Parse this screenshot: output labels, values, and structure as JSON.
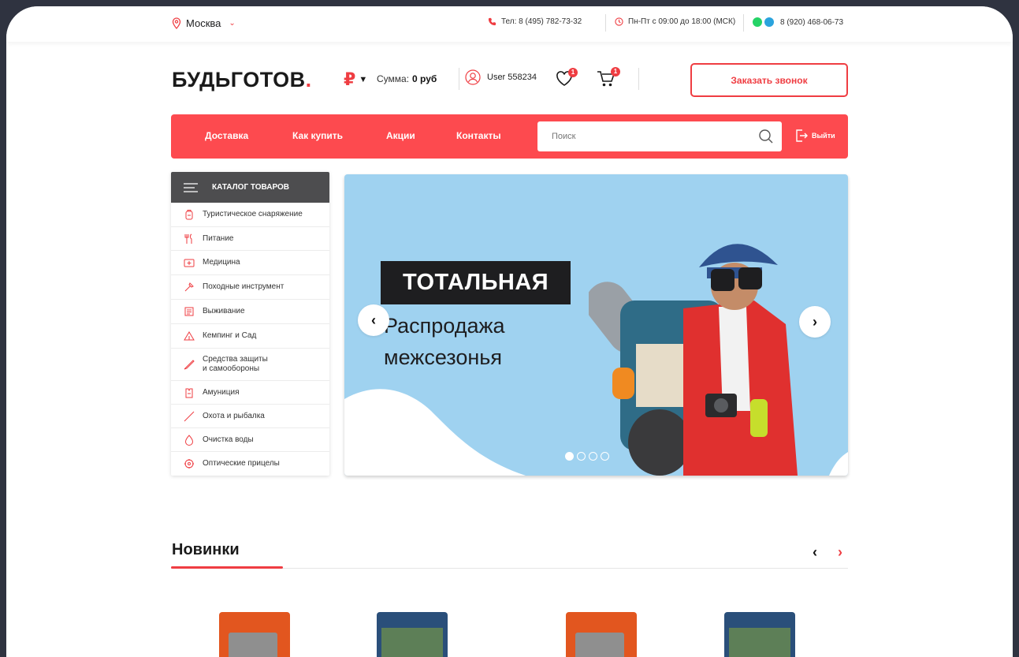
{
  "topbar": {
    "city": "Москва",
    "phone": "Тел: 8 (495) 782-73-32",
    "hours": "Пн-Пт с 09:00 до 18:00 (МСК)",
    "messenger_phone": "8 (920) 468-06-73"
  },
  "header": {
    "logo": "БУДЬГОТОВ",
    "logo_dot": ".",
    "currency_symbol": "₽",
    "sum_label": "Сумма:",
    "sum_value": "0 руб",
    "user": "User 558234",
    "favorites_count": "1",
    "cart_count": "1",
    "callback_button": "Заказать звонок"
  },
  "nav": {
    "items": [
      "Доставка",
      "Как купить",
      "Акции",
      "Контакты"
    ],
    "search_placeholder": "Поиск",
    "logout": "Выйти"
  },
  "catalog": {
    "title": "КАТАЛОГ ТОВАРОВ",
    "items": [
      {
        "label": "Туристическое снаряжение",
        "icon": "backpack-icon"
      },
      {
        "label": "Питание",
        "icon": "cutlery-icon"
      },
      {
        "label": "Медицина",
        "icon": "first-aid-icon"
      },
      {
        "label": "Походные инструмент",
        "icon": "tools-icon"
      },
      {
        "label": "Выживание",
        "icon": "survival-icon"
      },
      {
        "label": "Кемпинг и Сад",
        "icon": "tent-icon"
      },
      {
        "label": "Средства защиты",
        "label2": "и самообороны",
        "icon": "knife-icon"
      },
      {
        "label": "Амуниция",
        "icon": "vest-icon"
      },
      {
        "label": "Охота и рыбалка",
        "icon": "fishing-rod-icon"
      },
      {
        "label": "Очистка воды",
        "icon": "water-drop-icon"
      },
      {
        "label": "Оптические прицелы",
        "icon": "scope-icon"
      }
    ]
  },
  "banner": {
    "title": "ТОТАЛЬНАЯ",
    "subtitle": "Распродажа межсезонья",
    "slides_total": 4,
    "active_slide": 1
  },
  "section": {
    "title": "Новинки"
  },
  "colors": {
    "accent": "#ef3d42",
    "nav_bg": "#fd4a4f",
    "catalog_head": "#4d4d4f",
    "banner_bg": "#9fd2f0"
  }
}
